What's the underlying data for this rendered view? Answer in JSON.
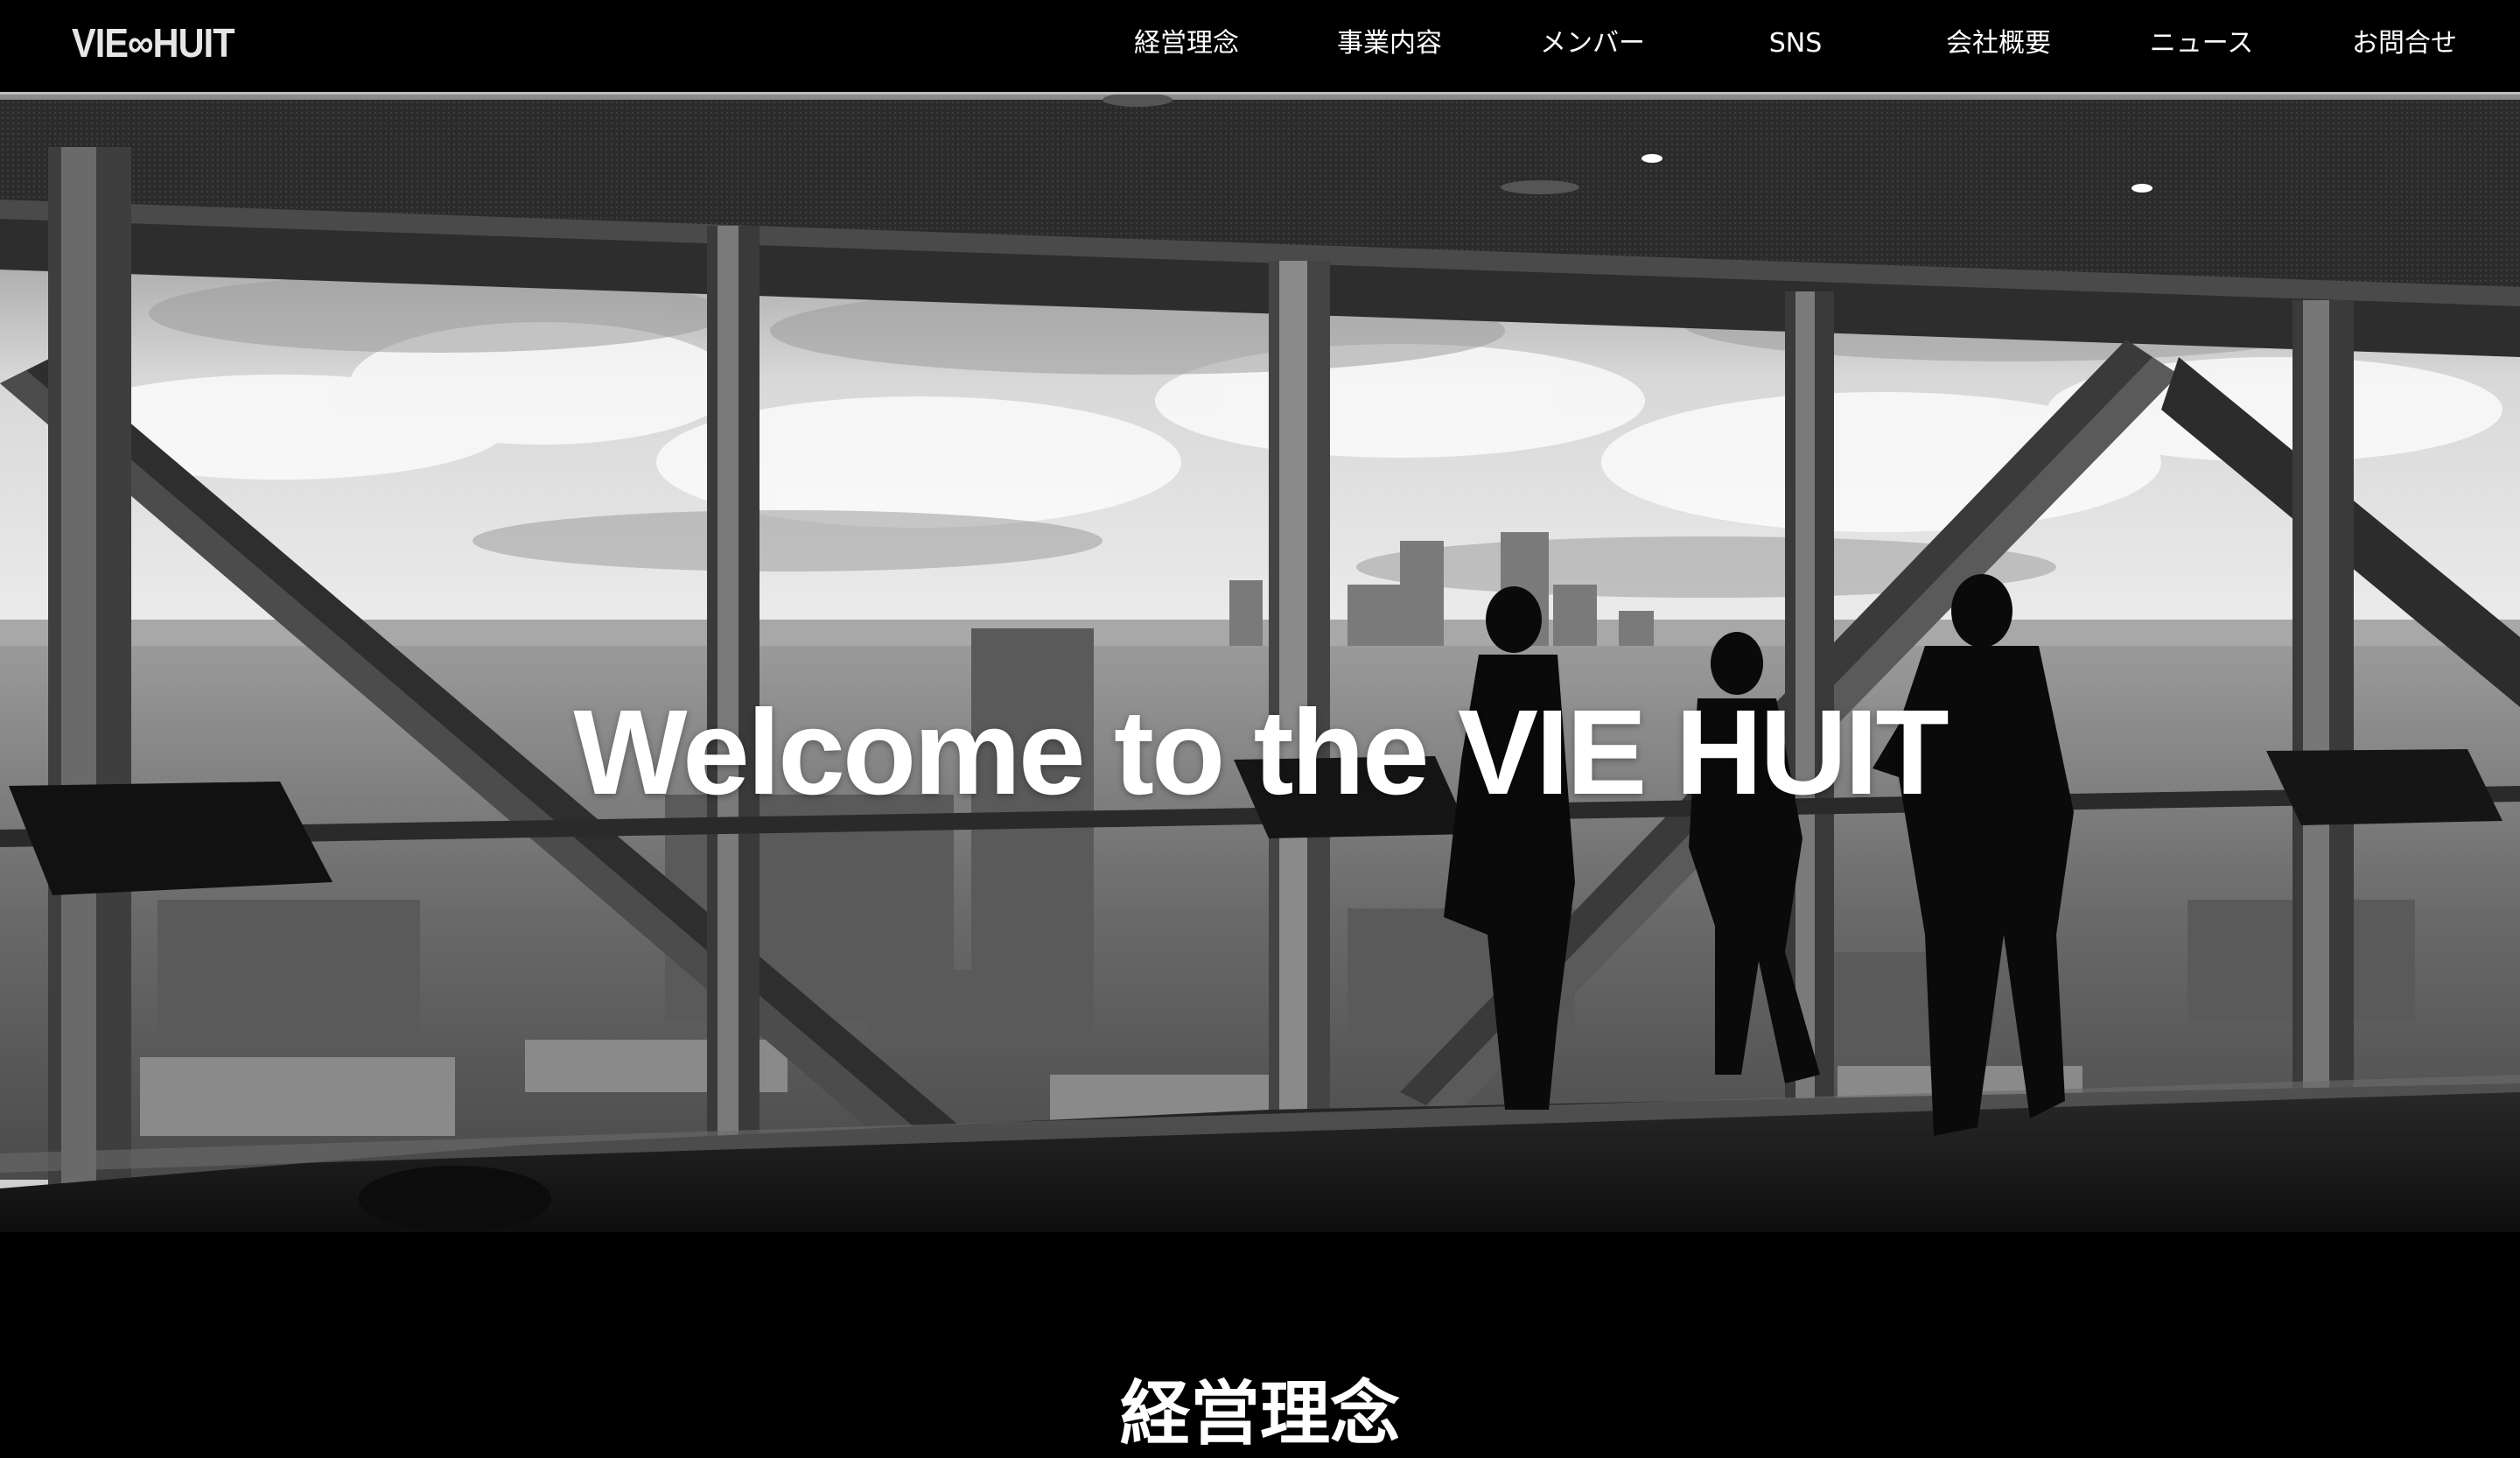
{
  "brand": {
    "logo_text": "VIE∞HUIT"
  },
  "nav": {
    "items": [
      {
        "label": "経営理念"
      },
      {
        "label": "事業内容"
      },
      {
        "label": "メンバー"
      },
      {
        "label": "SNS"
      },
      {
        "label": "会社概要"
      },
      {
        "label": "ニュース"
      },
      {
        "label": "お問合せ"
      }
    ]
  },
  "hero": {
    "headline": "Welcome to the VIE HUIT",
    "image_description": "black-and-white-office-window-city-skyline"
  },
  "sections": {
    "philosophy_title": "経営理念"
  },
  "colors": {
    "background": "#000000",
    "header_border": "#bdbdbd",
    "text": "#ffffff"
  }
}
